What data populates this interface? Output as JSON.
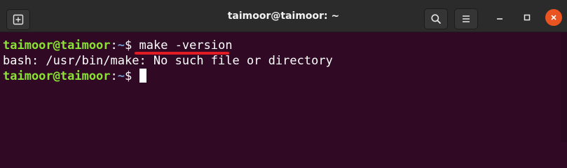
{
  "window": {
    "title": "taimoor@taimoor: ~"
  },
  "titlebar": {
    "new_tab_icon": "new-tab-icon",
    "search_icon": "search-icon",
    "menu_icon": "hamburger-menu-icon",
    "minimize_icon": "minimize-icon",
    "maximize_icon": "maximize-icon",
    "close_icon": "close-icon"
  },
  "terminal": {
    "lines": [
      {
        "user": "taimoor@taimoor",
        "sep": ":",
        "path": "~",
        "prompt": "$ ",
        "command": "make -version"
      },
      {
        "output": "bash: /usr/bin/make: No such file or directory"
      },
      {
        "user": "taimoor@taimoor",
        "sep": ":",
        "path": "~",
        "prompt": "$ ",
        "command": ""
      }
    ]
  },
  "colors": {
    "background": "#300a24",
    "titlebar": "#2b2b2b",
    "user": "#8ae234",
    "path": "#729fcf",
    "text": "#ffffff",
    "close_button": "#e95420",
    "annotation_underline": "#e01b24"
  }
}
